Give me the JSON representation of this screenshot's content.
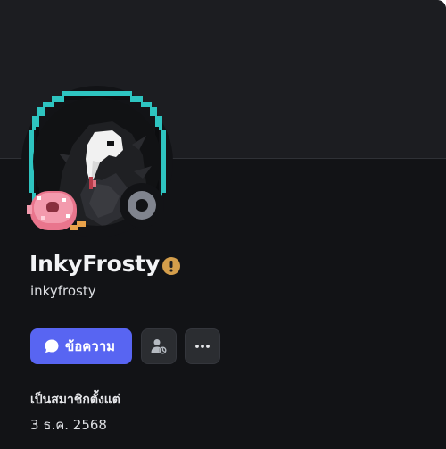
{
  "profile": {
    "display_name": "InkyFrosty",
    "username": "inkyfrosty",
    "status": "offline",
    "status_icon": "offline-status-icon",
    "name_badge_icon": "warning-icon"
  },
  "actions": {
    "message_label": "ข้อความ",
    "message_icon": "chat-bubble-icon",
    "friend_icon": "add-friend-pending-icon",
    "more_icon": "more-dots-icon"
  },
  "member": {
    "label": "เป็นสมาชิกตั้งแต่",
    "date": "3 ธ.ค. 2568"
  },
  "colors": {
    "accent": "#5865f2",
    "badge": "#d49e4b",
    "status_offline": "#80848e",
    "avatar_ring": "#2ec4c0"
  }
}
